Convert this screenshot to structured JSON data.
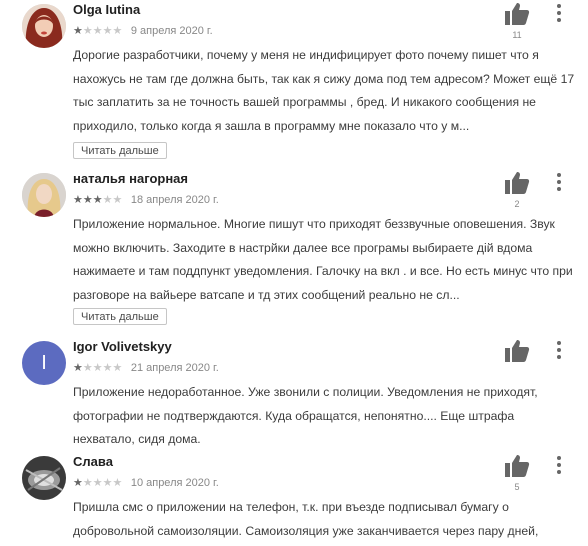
{
  "reviews": [
    {
      "author": "Olga Iutina",
      "rating": 1,
      "date": "9 апреля 2020 г.",
      "text": "Дорогие разработчики, почему у меня не индифицирует фото почему пишет что я нахожусь не там где должна быть, так как я сижу дома под тем адресом? Может ещё 17 тыс заплатить за не точность вашей программы , бред. И никакого сообщения не приходило, только когда я зашла в программу мне показало что у м...",
      "likes": "11",
      "more_label": "Читать дальше"
    },
    {
      "author": "наталья нагорная",
      "rating": 3,
      "date": "18 апреля 2020 г.",
      "text": "Приложение нормальное. Многие пишут что приходят беззвучные оповешения. Звук можно включить. Заходите в настрйки далее все програмы выбираете дiй вдома нажимаете и там поддпункт уведомления. Галочку на вкл . и все. Но есть минус что при разговоре на вайьере ватсапе и тд этих сообщений реально не сл...",
      "likes": "2",
      "more_label": "Читать дальше"
    },
    {
      "author": "Igor Volivetskyy",
      "avatar_letter": "I",
      "rating": 1,
      "date": "21 апреля 2020 г.",
      "text": "Приложение недоработанное. Уже звонили с полиции. Уведомления не приходят, фотографии не подтверждаются. Куда обращатся, непонятно.... Еще штрафа нехватало, сидя дома.",
      "likes": ""
    },
    {
      "author": "Слава",
      "rating": 1,
      "date": "10 апреля 2020 г.",
      "text": "Пришла смс о приложении на телефон, т.к. при въезде подписывал бумагу о добровольной самоизоляции. Самоизоляция уже заканчивается через пару дней,",
      "likes": "5"
    }
  ],
  "colors": {
    "avatar_letter_bg": "#5c6bc0",
    "star_filled": "#666666",
    "star_empty": "#c8c8c8"
  }
}
